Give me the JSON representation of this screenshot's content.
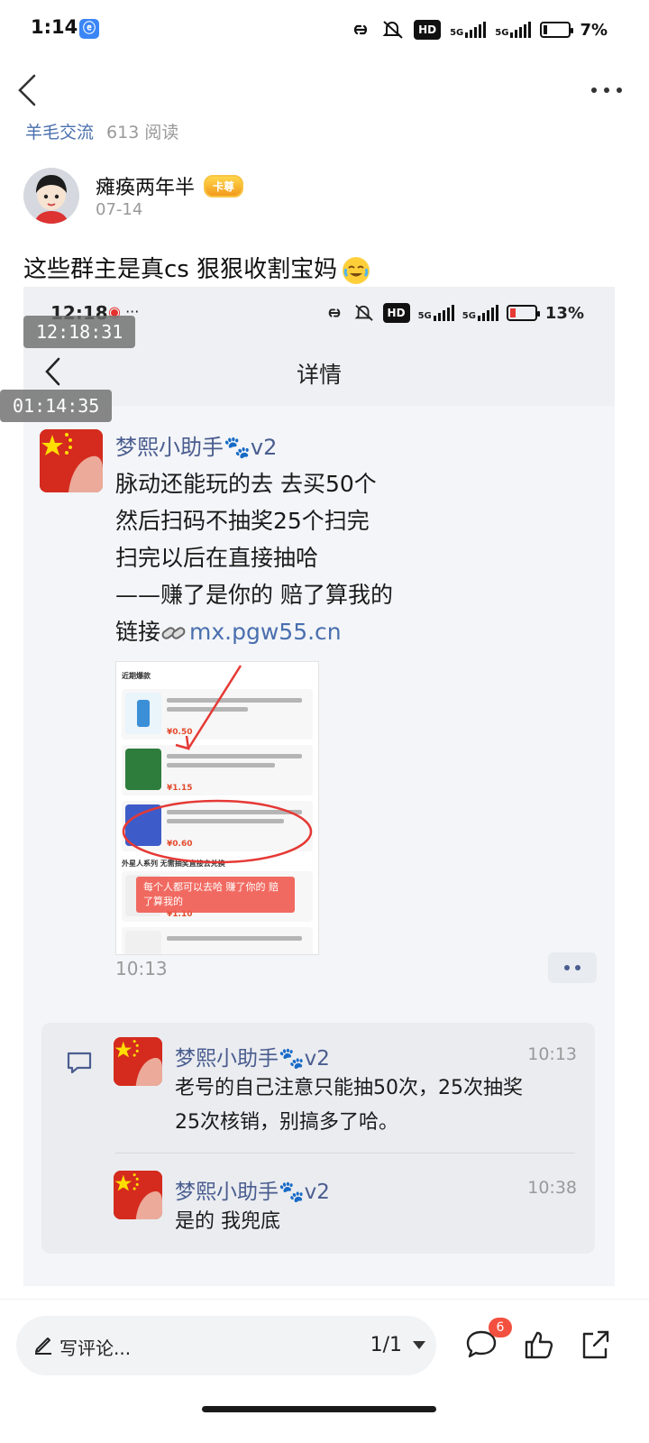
{
  "status_bar": {
    "time": "1:14",
    "hd": "HD",
    "net1": "5G",
    "net2": "5G",
    "battery": "7%"
  },
  "crumb": {
    "group": "羊毛交流",
    "reads": "613 阅读"
  },
  "author": {
    "name": "瘫痪两年半",
    "badge": "卡尊",
    "date": "07-14"
  },
  "post": {
    "text": "这些群主是真cs 狠狠收割宝妈"
  },
  "screenshot": {
    "status": {
      "time": "12:18",
      "dots": "···",
      "hd": "HD",
      "net1": "5G",
      "net2": "5G",
      "battery": "13%"
    },
    "title": "详情",
    "stamp_top": "12:18:31",
    "stamp_mid": "01:14:35",
    "message": {
      "author": "梦熙小助手🐾v2",
      "lines": [
        "脉动还能玩的去 去买50个",
        "然后扫码不抽奖25个扫完",
        "扫完以后在直接抽哈",
        "——赚了是你的 赔了算我的"
      ],
      "link_prefix": "链接",
      "link": "mx.pgw55.cn",
      "time": "10:13",
      "inner": {
        "section1": "近期爆款",
        "section2": "外星人系列 无需抽奖直接去兑换",
        "price1": "¥0.50",
        "price2": "¥1.15",
        "price3": "¥0.60",
        "price4": "¥1.10",
        "note": "每个人都可以去哈 赚了你的 赔了算我的"
      }
    },
    "replies": [
      {
        "author": "梦熙小助手🐾v2",
        "time": "10:13",
        "text_line1": "老号的自己注意只能抽50次，25次抽奖",
        "text_line2": "25次核销，别搞多了哈。"
      },
      {
        "author": "梦熙小助手🐾v2",
        "time": "10:38",
        "text_line1": "是的 我兜底"
      }
    ]
  },
  "bottom_bar": {
    "placeholder": "写评论...",
    "page": "1/1",
    "comment_count": "6"
  },
  "colors": {
    "link": "#4a6fae",
    "name": "#4a5d8f",
    "badge_red": "#f4503f"
  }
}
